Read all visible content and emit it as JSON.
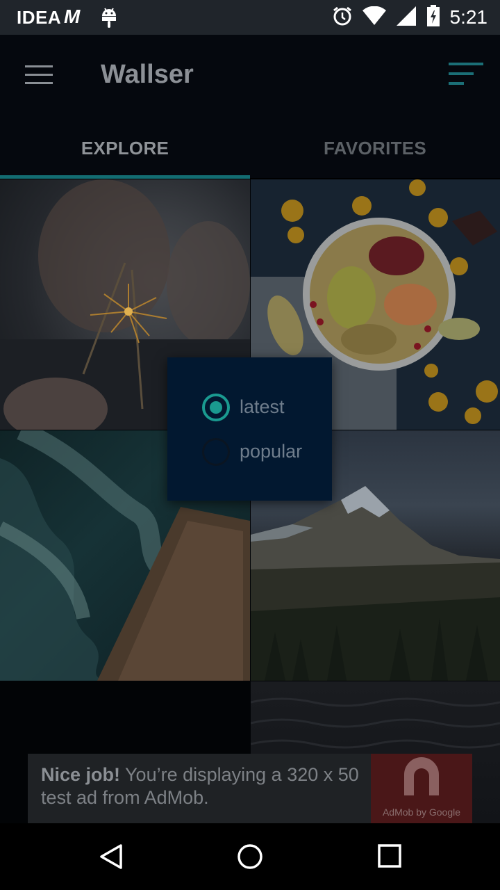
{
  "status_bar": {
    "carrier": "IDEA",
    "network_logo": "M",
    "time": "5:21",
    "icons": [
      "android-icon",
      "alarm-icon",
      "wifi-icon",
      "signal-icon",
      "battery-icon"
    ]
  },
  "app_bar": {
    "title": "Wallser",
    "menu_icon": "hamburger-menu-icon",
    "sort_icon": "sort-icon",
    "accent_color": "#136c71"
  },
  "tabs": [
    {
      "label": "EXPLORE",
      "selected": true
    },
    {
      "label": "FAVORITES",
      "selected": false
    }
  ],
  "sort_dialog": {
    "options": [
      {
        "label": "latest",
        "selected": true
      },
      {
        "label": "popular",
        "selected": false
      }
    ],
    "radio_color": "#1a9a90"
  },
  "grid": {
    "tiles": [
      "couple-sparkler-photo",
      "fruit-bowl-photo",
      "ocean-aerial-photo",
      "mountain-photo",
      "dark-photo",
      "water-surface-photo"
    ]
  },
  "ad": {
    "headline": "Nice job!",
    "body": " You’re displaying a 320 x 50 test ad from AdMob.",
    "logo_caption": "AdMob by Google"
  },
  "nav_bar": {
    "buttons": [
      "back-icon",
      "home-icon",
      "recents-icon"
    ]
  }
}
